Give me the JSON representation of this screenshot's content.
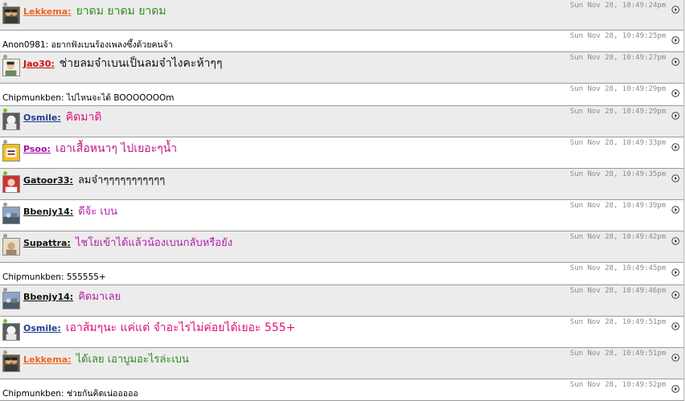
{
  "colors": {
    "online": "#6bc62a",
    "offline": "#9b9b9b",
    "row_grey": "#ececec",
    "row_white": "#ffffff",
    "timestamp": "#8c8c8c"
  },
  "messages": [
    {
      "kind": "user",
      "username": "Lekkema:",
      "text": "ยาดม ยาดม ยาดม",
      "time": "Sun Nov 28, 10:49:24pm",
      "user_color": "#ee6622",
      "text_color": "#2e8b1f",
      "size": 14,
      "status": "offline",
      "avatar_icon": "avatar-couple-icon"
    },
    {
      "kind": "plain",
      "text": "Anon0981: อยากฟังเบนร้องเพลงซึ้งด้วยคนจ้า",
      "time": "Sun Nov 28, 10:49:25pm"
    },
    {
      "kind": "user",
      "username": "Jao30:",
      "text": "ช่ายลมจ๋าเบนเป็นลมจ๋าไงคะห้าๆๆ",
      "time": "Sun Nov 28, 10:49:27pm",
      "user_color": "#cc1111",
      "text_color": "#111111",
      "size": 14,
      "status": "offline",
      "avatar_icon": "avatar-portrait-icon"
    },
    {
      "kind": "plain",
      "text": "Chipmunkben: ไปไหนจะได้ BOOOOOOOm",
      "time": "Sun Nov 28, 10:49:29pm"
    },
    {
      "kind": "user",
      "username": "Osmile:",
      "text": "คิดมาดิ",
      "time": "Sun Nov 28, 10:49:29pm",
      "user_color": "#1f3f8f",
      "text_color": "#e0107a",
      "size": 14,
      "status": "online",
      "avatar_icon": "avatar-white-icon"
    },
    {
      "kind": "user",
      "username": "Psoo:",
      "text": "เอาเสื้อหนาๆ ไปเยอะๆน้ำ",
      "time": "Sun Nov 28, 10:49:33pm",
      "user_color": "#aa10aa",
      "text_color": "#c0148a",
      "size": 14,
      "status": "offline",
      "avatar_icon": "avatar-yellow-icon"
    },
    {
      "kind": "user",
      "username": "Gatoor33:",
      "text": "ลมจ๋าๆๆๆๆๆๆๆๆๆๆๆ",
      "time": "Sun Nov 28, 10:49:35pm",
      "user_color": "#111111",
      "text_color": "#111111",
      "size": 13,
      "status": "online",
      "avatar_icon": "avatar-red-icon"
    },
    {
      "kind": "user",
      "username": "Bbenjy14:",
      "text": "ดีจ้ะ เบน",
      "time": "Sun Nov 28, 10:49:39pm",
      "user_color": "#111111",
      "text_color": "#b020a8",
      "size": 13,
      "status": "offline",
      "avatar_icon": "avatar-landscape-icon"
    },
    {
      "kind": "user",
      "username": "Supattra:",
      "text": "ไชโยเข้าได้แล้วน้องเบนกลับหรือยัง",
      "time": "Sun Nov 28, 10:49:42pm",
      "user_color": "#111111",
      "text_color": "#b020a8",
      "size": 13,
      "status": "offline",
      "avatar_icon": "avatar-beige-icon"
    },
    {
      "kind": "plain",
      "text": "Chipmunkben: 555555+",
      "time": "Sun Nov 28, 10:49:45pm"
    },
    {
      "kind": "user",
      "username": "Bbenjy14:",
      "text": "คิดมาเลย",
      "time": "Sun Nov 28, 10:49:46pm",
      "user_color": "#111111",
      "text_color": "#b020a8",
      "size": 13,
      "status": "offline",
      "avatar_icon": "avatar-landscape-icon"
    },
    {
      "kind": "user",
      "username": "Osmile:",
      "text": "เอาส้มๆนะ แค่แต่ จำอะไรไม่ค่อยได้เยอะ 555+",
      "time": "Sun Nov 28, 10:49:51pm",
      "user_color": "#1f3f8f",
      "text_color": "#e0107a",
      "size": 14,
      "status": "online",
      "avatar_icon": "avatar-white-icon"
    },
    {
      "kind": "user",
      "username": "Lekkema:",
      "text": "ได้เลย เอาบูมอะไรล่ะเบน",
      "time": "Sun Nov 28, 10:49:51pm",
      "user_color": "#ee6622",
      "text_color": "#2e8b1f",
      "size": 13,
      "status": "offline",
      "avatar_icon": "avatar-couple-icon"
    },
    {
      "kind": "plain",
      "text": "Chipmunkben: ช่วยกันคิดเน่อออออ",
      "time": "Sun Nov 28, 10:49:52pm"
    }
  ]
}
